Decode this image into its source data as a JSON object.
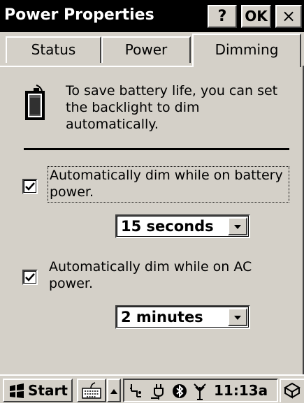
{
  "window": {
    "title": "Power Properties",
    "help_label": "?",
    "ok_label": "OK",
    "close_label": "×"
  },
  "tabs": [
    {
      "label": "Status",
      "selected": false
    },
    {
      "label": "Power",
      "selected": false
    },
    {
      "label": "Dimming",
      "selected": true
    }
  ],
  "info": {
    "icon": "battery-icon",
    "text": "To save battery life, you can set the backlight to dim automatically."
  },
  "options": {
    "battery": {
      "checked": true,
      "label": "Automatically dim while on battery power.",
      "timeout": "15 seconds"
    },
    "ac": {
      "checked": true,
      "label": "Automatically dim while on AC power.",
      "timeout": "2 minutes"
    }
  },
  "taskbar": {
    "start_label": "Start",
    "icons": [
      "start-flag-icon",
      "keyboard-icon",
      "up-arrow-icon",
      "network-icon",
      "power-plug-icon",
      "bluetooth-icon",
      "antenna-icon",
      "desktop-icon"
    ],
    "clock": "11:13a"
  }
}
